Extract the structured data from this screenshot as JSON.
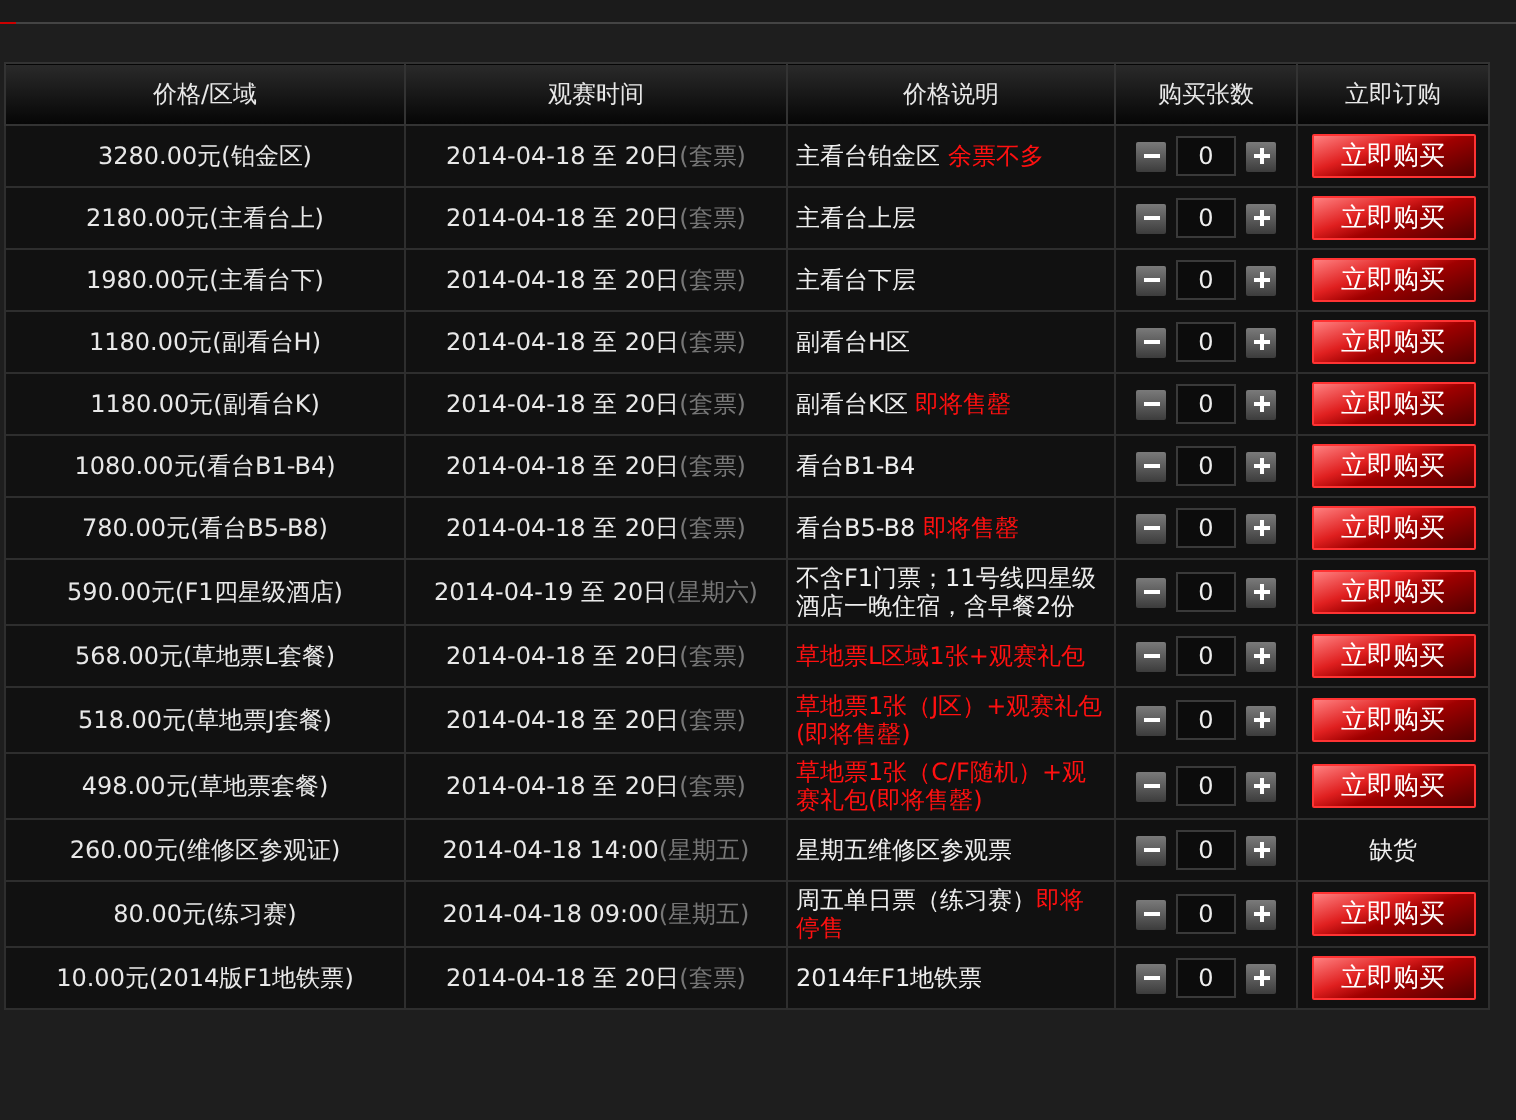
{
  "table": {
    "columns": [
      "价格/区域",
      "观赛时间",
      "价格说明",
      "购买张数",
      "立即订购"
    ],
    "rows": [
      {
        "price": "3280.00元(铂金区)",
        "date": "2014-04-18 至 20日",
        "date_note": "(套票)",
        "description": [
          {
            "text": "主看台铂金区 ",
            "alert": false
          },
          {
            "text": "余票不多",
            "alert": true
          }
        ],
        "quantity": "0",
        "action": {
          "kind": "button",
          "label": "立即购买"
        }
      },
      {
        "price": "2180.00元(主看台上)",
        "date": "2014-04-18 至 20日",
        "date_note": "(套票)",
        "description": [
          {
            "text": "主看台上层",
            "alert": false
          }
        ],
        "quantity": "0",
        "action": {
          "kind": "button",
          "label": "立即购买"
        }
      },
      {
        "price": "1980.00元(主看台下)",
        "date": "2014-04-18 至 20日",
        "date_note": "(套票)",
        "description": [
          {
            "text": "主看台下层",
            "alert": false
          }
        ],
        "quantity": "0",
        "action": {
          "kind": "button",
          "label": "立即购买"
        }
      },
      {
        "price": "1180.00元(副看台H)",
        "date": "2014-04-18 至 20日",
        "date_note": "(套票)",
        "description": [
          {
            "text": "副看台H区",
            "alert": false
          }
        ],
        "quantity": "0",
        "action": {
          "kind": "button",
          "label": "立即购买"
        }
      },
      {
        "price": "1180.00元(副看台K)",
        "date": "2014-04-18 至 20日",
        "date_note": "(套票)",
        "description": [
          {
            "text": "副看台K区 ",
            "alert": false
          },
          {
            "text": "即将售罄",
            "alert": true
          }
        ],
        "quantity": "0",
        "action": {
          "kind": "button",
          "label": "立即购买"
        }
      },
      {
        "price": "1080.00元(看台B1-B4)",
        "date": "2014-04-18 至 20日",
        "date_note": "(套票)",
        "description": [
          {
            "text": "看台B1-B4",
            "alert": false
          }
        ],
        "quantity": "0",
        "action": {
          "kind": "button",
          "label": "立即购买"
        }
      },
      {
        "price": "780.00元(看台B5-B8)",
        "date": "2014-04-18 至 20日",
        "date_note": "(套票)",
        "description": [
          {
            "text": "看台B5-B8 ",
            "alert": false
          },
          {
            "text": "即将售罄",
            "alert": true
          }
        ],
        "quantity": "0",
        "action": {
          "kind": "button",
          "label": "立即购买"
        }
      },
      {
        "price": "590.00元(F1四星级酒店)",
        "date": "2014-04-19 至 20日",
        "date_note": "(星期六)",
        "description": [
          {
            "text": "不含F1门票；11号线四星级酒店一晚住宿，含早餐2份",
            "alert": false
          }
        ],
        "quantity": "0",
        "action": {
          "kind": "button",
          "label": "立即购买"
        }
      },
      {
        "price": "568.00元(草地票L套餐)",
        "date": "2014-04-18 至 20日",
        "date_note": "(套票)",
        "description": [
          {
            "text": "草地票L区域1张+观赛礼包",
            "alert": true
          }
        ],
        "quantity": "0",
        "action": {
          "kind": "button",
          "label": "立即购买"
        }
      },
      {
        "price": "518.00元(草地票J套餐)",
        "date": "2014-04-18 至 20日",
        "date_note": "(套票)",
        "description": [
          {
            "text": "草地票1张（J区）+观赛礼包(即将售罄)",
            "alert": true
          }
        ],
        "quantity": "0",
        "action": {
          "kind": "button",
          "label": "立即购买"
        }
      },
      {
        "price": "498.00元(草地票套餐)",
        "date": "2014-04-18 至 20日",
        "date_note": "(套票)",
        "description": [
          {
            "text": "草地票1张（C/F随机）+观赛礼包(即将售罄)",
            "alert": true
          }
        ],
        "quantity": "0",
        "action": {
          "kind": "button",
          "label": "立即购买"
        }
      },
      {
        "price": "260.00元(维修区参观证)",
        "date": "2014-04-18 14:00",
        "date_note": "(星期五)",
        "description": [
          {
            "text": "星期五维修区参观票",
            "alert": false
          }
        ],
        "quantity": "0",
        "action": {
          "kind": "text",
          "label": "缺货"
        }
      },
      {
        "price": "80.00元(练习赛)",
        "date": "2014-04-18 09:00",
        "date_note": "(星期五)",
        "description": [
          {
            "text": "周五单日票（练习赛）",
            "alert": false
          },
          {
            "text": "即将停售",
            "alert": true
          }
        ],
        "quantity": "0",
        "action": {
          "kind": "button",
          "label": "立即购买"
        }
      },
      {
        "price": "10.00元(2014版F1地铁票)",
        "date": "2014-04-18 至 20日",
        "date_note": "(套票)",
        "description": [
          {
            "text": "2014年F1地铁票",
            "alert": false
          }
        ],
        "quantity": "0",
        "action": {
          "kind": "button",
          "label": "立即购买"
        }
      }
    ]
  }
}
